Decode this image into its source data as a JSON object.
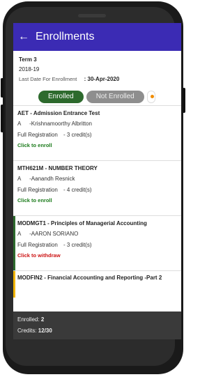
{
  "header": {
    "title": "Enrollments"
  },
  "term": {
    "name": "Term 3",
    "year": "2018-19",
    "last_date_label": "Last Date For Enrollment",
    "last_date_value": ": 30-Apr-2020"
  },
  "filters": {
    "enrolled": "Enrolled",
    "not_enrolled": "Not Enrolled"
  },
  "courses": [
    {
      "name": "AET - Admission Entrance Test",
      "section": "A",
      "instructor": "-Krishnamoorthy Albritton",
      "registration": "Full Registration",
      "credits": "- 3 credit(s)",
      "action": "Click to enroll"
    },
    {
      "name": "MTH621M - NUMBER THEORY",
      "section": "A",
      "instructor": "-Aanandh Resnick",
      "registration": "Full Registration",
      "credits": "- 4 credit(s)",
      "action": "Click to enroll"
    },
    {
      "name": "MODMGT1 - Principles of Managerial Accounting",
      "section": "A",
      "instructor": "-AARON SORIANO",
      "registration": "Full Registration",
      "credits": "- 3 credit(s)",
      "action": "Click to withdraw"
    },
    {
      "name": "MODFIN2 - Financial Accounting and Reporting -Part 2"
    }
  ],
  "footer": {
    "enrolled_label": "Enrolled:",
    "enrolled_value": "2",
    "credits_label": "Credits:",
    "credits_value": "12/30"
  },
  "colors": {
    "appbar": "#3b2bb4",
    "enrolled_chip": "#2d6a2d",
    "withdraw": "#cc1111",
    "enroll": "#1a7a1a",
    "pending_bar": "#f0b400"
  },
  "icons": {
    "back": "arrow-left-icon"
  }
}
